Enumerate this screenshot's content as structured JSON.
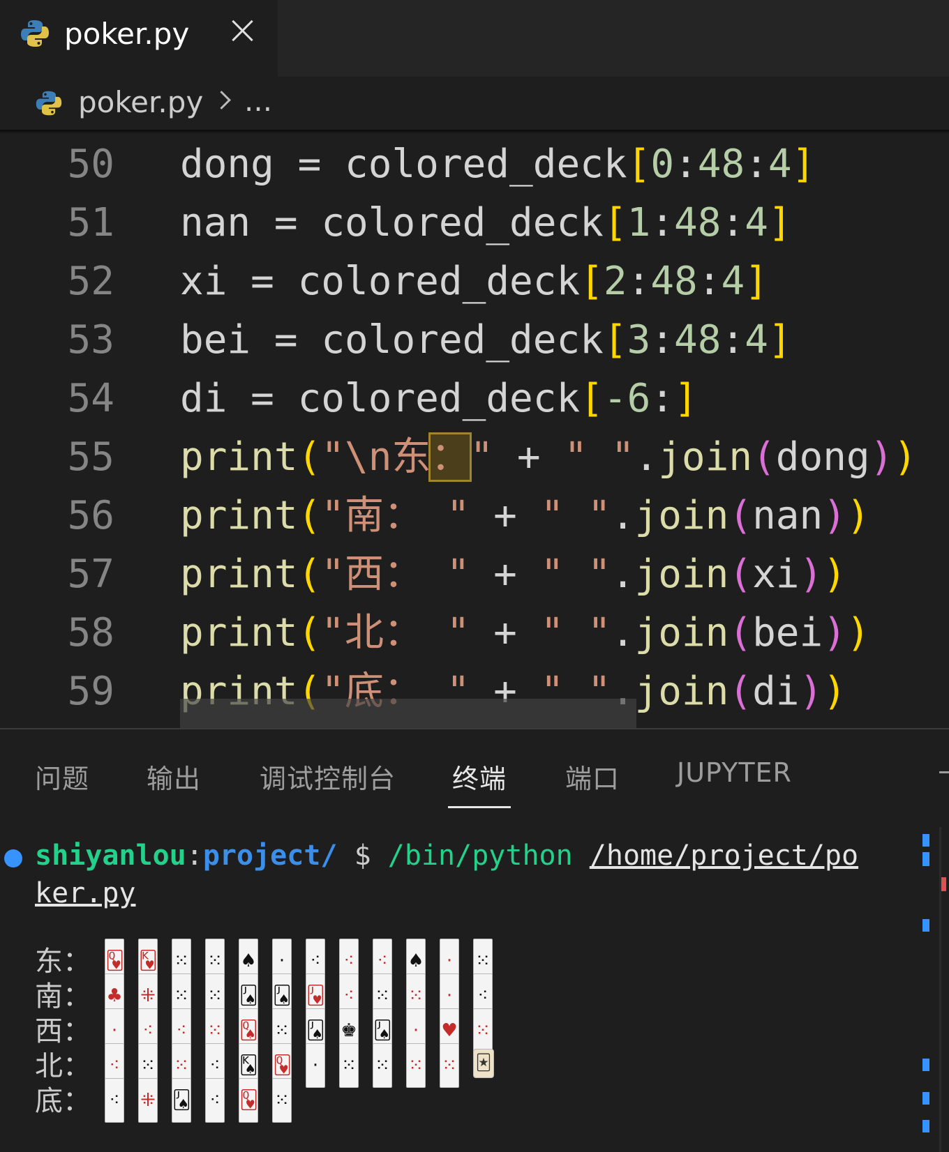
{
  "tab": {
    "title": "poker.py",
    "close": "close"
  },
  "breadcrumb": {
    "file": "poker.py",
    "more": "..."
  },
  "editor": {
    "lines": [
      {
        "num": "50",
        "tokens": [
          [
            "dong",
            ""
          ],
          [
            " = ",
            ""
          ],
          [
            "colored_deck",
            ""
          ],
          [
            "[",
            "br"
          ],
          [
            "0",
            "num"
          ],
          [
            ":",
            ""
          ],
          [
            "48",
            "num"
          ],
          [
            ":",
            ""
          ],
          [
            "4",
            "num"
          ],
          [
            "]",
            "br"
          ]
        ]
      },
      {
        "num": "51",
        "tokens": [
          [
            "nan",
            ""
          ],
          [
            " = ",
            ""
          ],
          [
            "colored_deck",
            ""
          ],
          [
            "[",
            "br"
          ],
          [
            "1",
            "num"
          ],
          [
            ":",
            ""
          ],
          [
            "48",
            "num"
          ],
          [
            ":",
            ""
          ],
          [
            "4",
            "num"
          ],
          [
            "]",
            "br"
          ]
        ]
      },
      {
        "num": "52",
        "tokens": [
          [
            "xi",
            ""
          ],
          [
            " = ",
            ""
          ],
          [
            "colored_deck",
            ""
          ],
          [
            "[",
            "br"
          ],
          [
            "2",
            "num"
          ],
          [
            ":",
            ""
          ],
          [
            "48",
            "num"
          ],
          [
            ":",
            ""
          ],
          [
            "4",
            "num"
          ],
          [
            "]",
            "br"
          ]
        ]
      },
      {
        "num": "53",
        "tokens": [
          [
            "bei",
            ""
          ],
          [
            " = ",
            ""
          ],
          [
            "colored_deck",
            ""
          ],
          [
            "[",
            "br"
          ],
          [
            "3",
            "num"
          ],
          [
            ":",
            ""
          ],
          [
            "48",
            "num"
          ],
          [
            ":",
            ""
          ],
          [
            "4",
            "num"
          ],
          [
            "]",
            "br"
          ]
        ]
      },
      {
        "num": "54",
        "tokens": [
          [
            "di",
            ""
          ],
          [
            " = ",
            ""
          ],
          [
            "colored_deck",
            ""
          ],
          [
            "[",
            "br"
          ],
          [
            "-6",
            "num"
          ],
          [
            ":",
            ""
          ],
          [
            "]",
            "br"
          ]
        ]
      },
      {
        "num": "55",
        "tokens": [
          [
            "print",
            "fn"
          ],
          [
            "(",
            "br"
          ],
          [
            "\"\\n东",
            "str"
          ],
          [
            "：",
            "hl"
          ],
          [
            "\"",
            "str"
          ],
          [
            " + ",
            ""
          ],
          [
            "\" \"",
            "str"
          ],
          [
            ".",
            ""
          ],
          [
            "join",
            "fn"
          ],
          [
            "(",
            "br2"
          ],
          [
            "dong",
            ""
          ],
          [
            ")",
            "br2"
          ],
          [
            ")",
            "br"
          ]
        ]
      },
      {
        "num": "56",
        "tokens": [
          [
            "print",
            "fn"
          ],
          [
            "(",
            "br"
          ],
          [
            "\"南： \"",
            "str"
          ],
          [
            " + ",
            ""
          ],
          [
            "\" \"",
            "str"
          ],
          [
            ".",
            ""
          ],
          [
            "join",
            "fn"
          ],
          [
            "(",
            "br2"
          ],
          [
            "nan",
            ""
          ],
          [
            ")",
            "br2"
          ],
          [
            ")",
            "br"
          ]
        ]
      },
      {
        "num": "57",
        "tokens": [
          [
            "print",
            "fn"
          ],
          [
            "(",
            "br"
          ],
          [
            "\"西： \"",
            "str"
          ],
          [
            " + ",
            ""
          ],
          [
            "\" \"",
            "str"
          ],
          [
            ".",
            ""
          ],
          [
            "join",
            "fn"
          ],
          [
            "(",
            "br2"
          ],
          [
            "xi",
            ""
          ],
          [
            ")",
            "br2"
          ],
          [
            ")",
            "br"
          ]
        ]
      },
      {
        "num": "58",
        "tokens": [
          [
            "print",
            "fn"
          ],
          [
            "(",
            "br"
          ],
          [
            "\"北： \"",
            "str"
          ],
          [
            " + ",
            ""
          ],
          [
            "\" \"",
            "str"
          ],
          [
            ".",
            ""
          ],
          [
            "join",
            "fn"
          ],
          [
            "(",
            "br2"
          ],
          [
            "bei",
            ""
          ],
          [
            ")",
            "br2"
          ],
          [
            ")",
            "br"
          ]
        ]
      },
      {
        "num": "59",
        "tokens": [
          [
            "print",
            "fn"
          ],
          [
            "(",
            "br"
          ],
          [
            "\"底： \"",
            "str"
          ],
          [
            " + ",
            ""
          ],
          [
            "\" \"",
            "str"
          ],
          [
            ".",
            ""
          ],
          [
            "join",
            "fn"
          ],
          [
            "(",
            "br2"
          ],
          [
            "di",
            ""
          ],
          [
            ")",
            "br2"
          ],
          [
            ")",
            "br"
          ]
        ]
      }
    ]
  },
  "panel": {
    "tabs": [
      "问题",
      "输出",
      "调试控制台",
      "终端",
      "端口",
      "JUPYTER"
    ],
    "active_tab": "终端"
  },
  "terminal": {
    "user": "shiyanlou",
    "colon": ":",
    "path": "project/",
    "dollar": "$",
    "cmd": "/bin/python",
    "arg_part1": "/home/project/po",
    "arg_part2": "ker.py",
    "hands": [
      {
        "label": "东：",
        "cards": [
          "r:🂽",
          "r:🂾",
          "b:⁙",
          "b:⁙",
          "b:♠",
          "b:·",
          "b:⁖",
          "r:⁖",
          "r:⁖",
          "b:♠",
          "r:·",
          "b:⁙"
        ]
      },
      {
        "label": "南：",
        "cards": [
          "r:♣",
          "r:⁜",
          "b:⁙",
          "b:⁙",
          "b:🂫",
          "b:🂫",
          "r:🂻",
          "r:⁖",
          "b:⁙",
          "r:⁙",
          "r:·",
          "b:⁖"
        ]
      },
      {
        "label": "西：",
        "cards": [
          "r:·",
          "r:⁖",
          "r:⁖",
          "r:⁙",
          "r:🂭",
          "b:⁙",
          "b:🂫",
          "b:♚",
          "b:🂫",
          "r:·",
          "r:♥",
          "r:⁙"
        ]
      },
      {
        "label": "北：",
        "cards": [
          "r:⁖",
          "b:⁙",
          "r:⁙",
          "b:⁖",
          "b:🂮",
          "r:🂽",
          "b:·",
          "b:⁙",
          "b:⁙",
          "r:⁙",
          "r:⁙",
          "j:🃏"
        ]
      },
      {
        "label": "底：",
        "cards": [
          "b:⁖",
          "r:⁜",
          "b:🂫",
          "b:⁖",
          "r:🂽",
          "b:⁙"
        ]
      }
    ]
  },
  "colors": {
    "bg": "#1e1e1e",
    "identifier": "#d4d4d4",
    "function": "#dcdcaa",
    "string": "#ce9178",
    "number": "#b5cea8",
    "bracket1": "#ffd700",
    "bracket2": "#da70d6",
    "terminal_green": "#23d18b",
    "terminal_blue": "#3b8eea",
    "accent": "#3794ff",
    "card_red": "#c42b2b",
    "card_black": "#111111"
  }
}
